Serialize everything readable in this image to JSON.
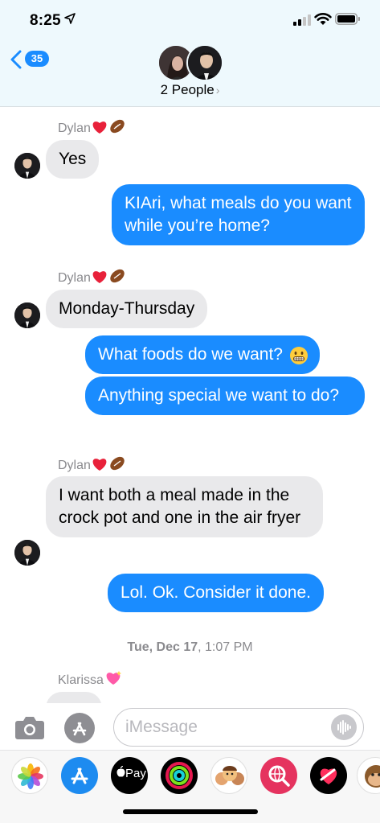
{
  "status_bar": {
    "time": "8:25"
  },
  "header": {
    "back_count": "35",
    "title": "2 People"
  },
  "messages": [
    {
      "sender": "Dylan",
      "text": "Yes"
    },
    {
      "text": "KIAri, what meals do you want while you’re home?"
    },
    {
      "sender": "Dylan",
      "text": "Monday-Thursday"
    },
    {
      "text": "What foods do we want?"
    },
    {
      "text": "Anything special we want to do?"
    },
    {
      "sender": "Dylan",
      "text": "I want both a meal made in the crock pot and one in the air fryer"
    },
    {
      "text": "Lol. Ok. Consider it done."
    }
  ],
  "timestamp": {
    "day": "Tue, Dec 17",
    "time": ", 1:07 PM"
  },
  "last_sender": "Klarissa",
  "composer": {
    "placeholder": "iMessage"
  },
  "drawer": {
    "apps": [
      "photos-app",
      "app-store-app",
      "apple-pay-app",
      "activity-app",
      "memoji-app",
      "web-search-app",
      "digital-touch-app",
      "animoji-app"
    ],
    "apple_pay_label": "Pay"
  },
  "colors": {
    "outgoing": "#1a8cff",
    "incoming": "#e9e9eb",
    "header_bg": "#eef9fd"
  }
}
